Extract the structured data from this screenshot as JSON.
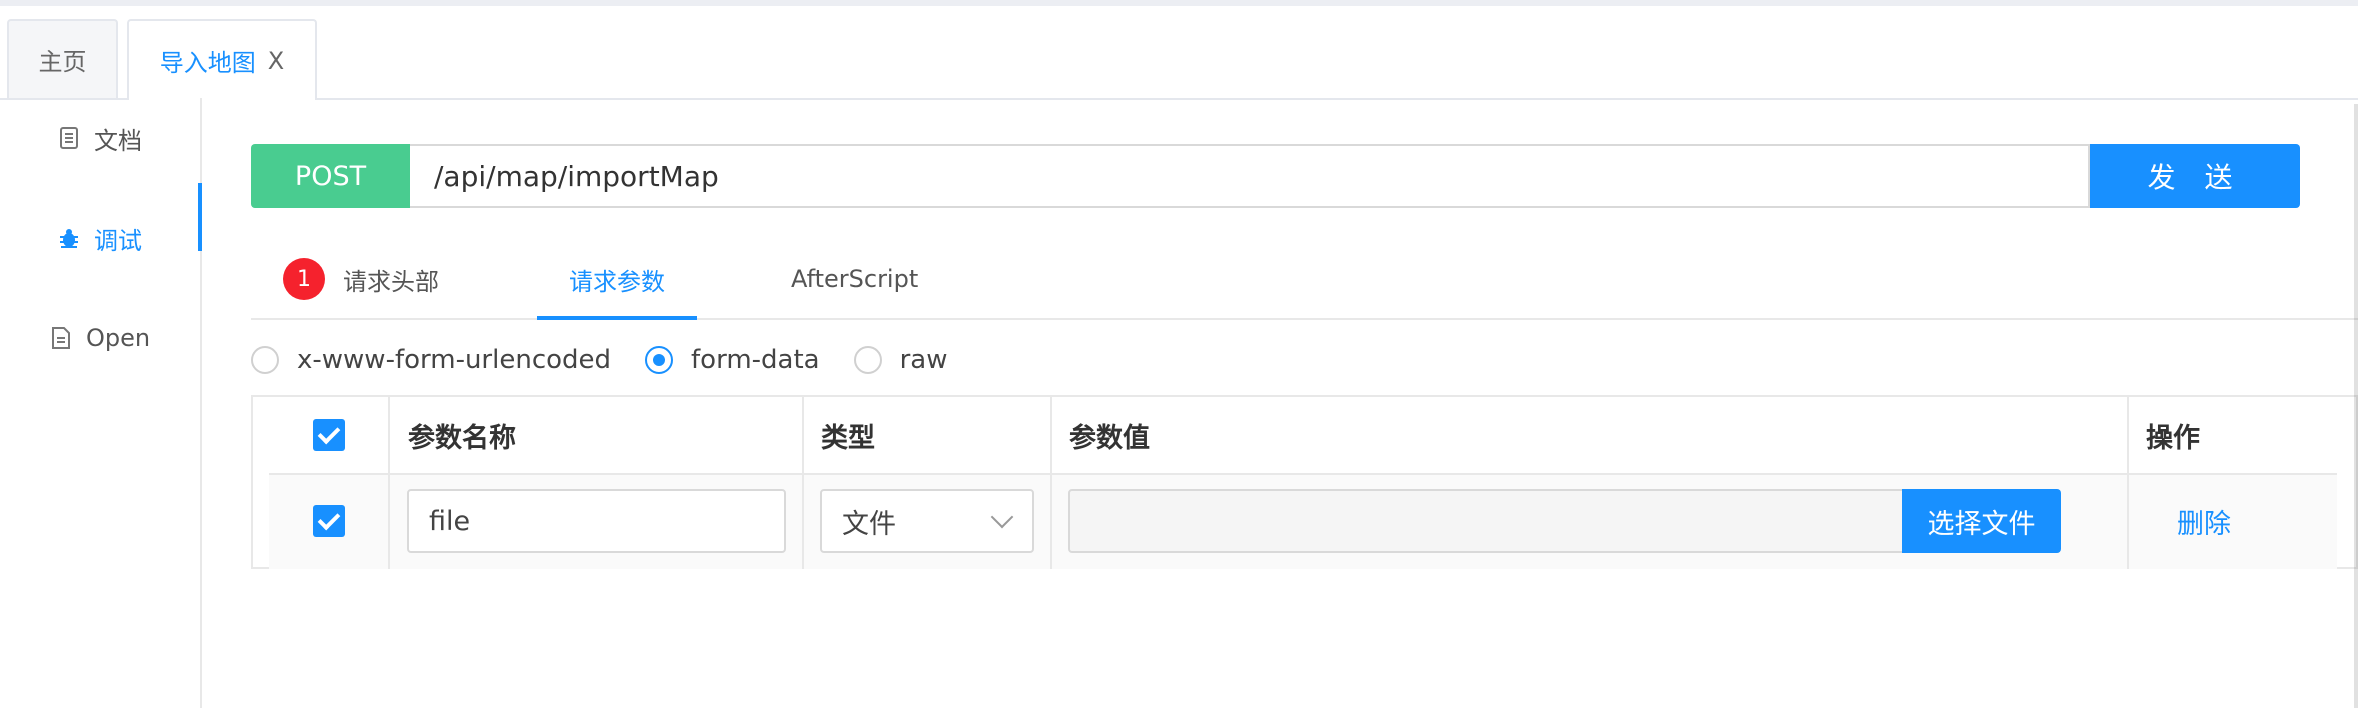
{
  "tabs": {
    "home": "主页",
    "active": "导入地图",
    "close": "X"
  },
  "sidebar": {
    "items": [
      {
        "label": "文档",
        "icon": "document-icon"
      },
      {
        "label": "调试",
        "icon": "bug-icon"
      },
      {
        "label": "Open",
        "icon": "file-icon"
      }
    ]
  },
  "request": {
    "method": "POST",
    "url": "/api/map/importMap",
    "send": "发 送"
  },
  "subtabs": {
    "headers_badge": "1",
    "headers": "请求头部",
    "params": "请求参数",
    "afterscript": "AfterScript"
  },
  "body_types": {
    "options": [
      "x-www-form-urlencoded",
      "form-data",
      "raw"
    ],
    "selected": "form-data"
  },
  "params_table": {
    "columns": [
      "参数名称",
      "类型",
      "参数值",
      "操作"
    ],
    "rows": [
      {
        "checked": true,
        "name": "file",
        "type": "文件",
        "value": "",
        "file_button": "选择文件",
        "action": "删除"
      }
    ]
  },
  "colors": {
    "accent": "#1890ff",
    "post": "#49cc90",
    "badge": "#f5222d"
  }
}
